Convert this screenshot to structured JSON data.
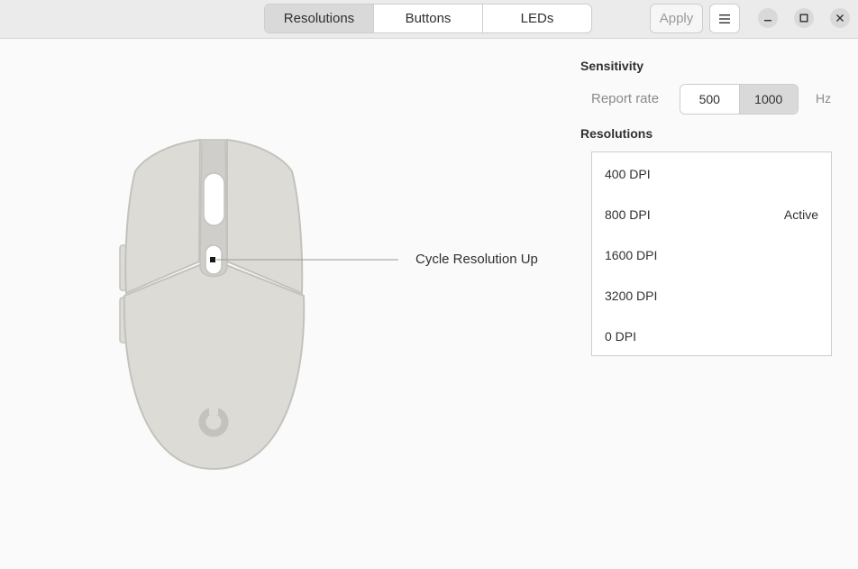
{
  "tabs": [
    {
      "label": "Resolutions",
      "active": true
    },
    {
      "label": "Buttons",
      "active": false
    },
    {
      "label": "LEDs",
      "active": false
    }
  ],
  "toolbar": {
    "apply_label": "Apply",
    "menu_icon": "hamburger-menu-icon"
  },
  "window_controls": {
    "minimize_icon": "minimize-icon",
    "maximize_icon": "maximize-icon",
    "close_icon": "close-icon"
  },
  "sensitivity": {
    "title": "Sensitivity",
    "report_rate_label": "Report rate",
    "rates": [
      {
        "label": "500",
        "active": false
      },
      {
        "label": "1000",
        "active": true
      }
    ],
    "unit": "Hz"
  },
  "resolutions": {
    "title": "Resolutions",
    "items": [
      {
        "label": "400 DPI",
        "status": ""
      },
      {
        "label": "800 DPI",
        "status": "Active"
      },
      {
        "label": "1600 DPI",
        "status": ""
      },
      {
        "label": "3200 DPI",
        "status": ""
      },
      {
        "label": "0 DPI",
        "status": ""
      }
    ]
  },
  "mouse": {
    "callout_label": "Cycle Resolution Up",
    "body_color": "#dcdbd6",
    "outline_color": "#c3c2bc"
  },
  "colors": {
    "header_bg": "#ebebeb",
    "window_bg": "#fafafa",
    "active_toggle": "#d9d9d9"
  }
}
